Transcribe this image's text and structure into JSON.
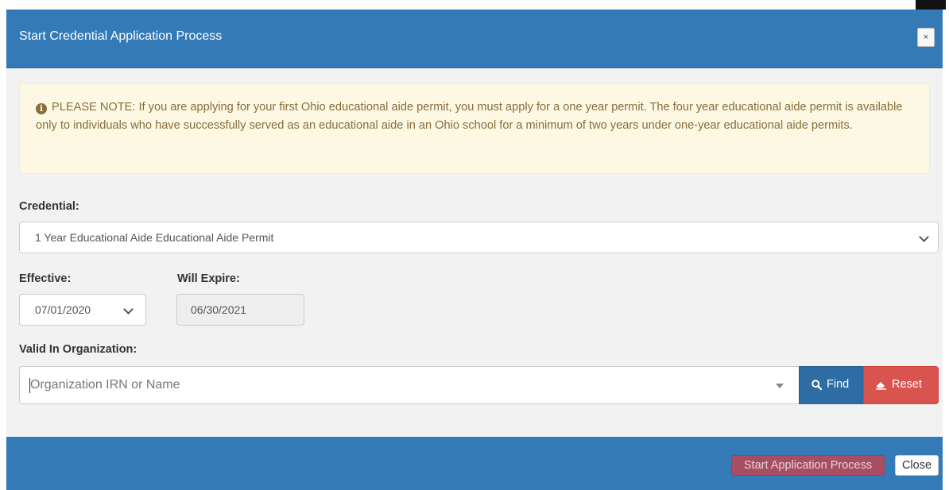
{
  "modal": {
    "title": "Start Credential Application Process",
    "close_icon": "×"
  },
  "notice": {
    "icon": "info-circle-icon",
    "text": "PLEASE NOTE: If you are applying for your first Ohio educational aide permit, you must apply for a one year permit. The four year educational aide permit is available only to individuals who have successfully served as an educational aide in an Ohio school for a minimum of two years under one-year educational aide permits."
  },
  "form": {
    "credential_label": "Credential:",
    "credential_value": "1 Year Educational Aide Educational Aide Permit",
    "effective_label": "Effective:",
    "effective_value": "07/01/2020",
    "expire_label": "Will Expire:",
    "expire_value": "06/30/2021",
    "organization_label": "Valid In Organization:",
    "organization_placeholder": "Organization IRN or Name",
    "find_label": "Find",
    "reset_label": "Reset"
  },
  "footer": {
    "start_label": "Start Application Process",
    "close_label": "Close"
  },
  "colors": {
    "header": "#337ab7",
    "alert_bg": "#fcf8e3",
    "alert_text": "#8a6d3b",
    "find_button": "#2e6da4",
    "reset_button": "#d9534f",
    "start_button": "#b24b5b"
  }
}
